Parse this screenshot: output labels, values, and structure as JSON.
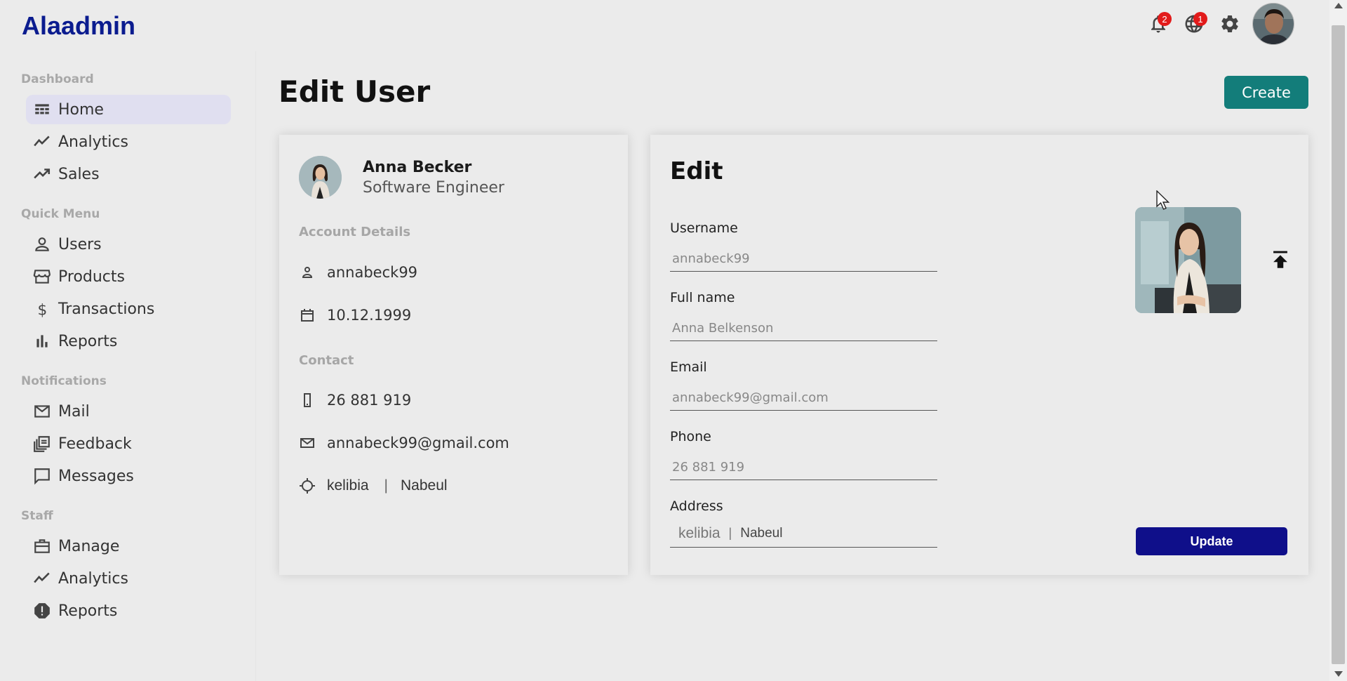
{
  "app": {
    "logo": "Alaadmin",
    "notifications_count": "2",
    "language_count": "1",
    "accent_color": "#137d7a",
    "primary_color": "#0f0f8a",
    "logo_color": "#0b1c8f"
  },
  "sidebar": {
    "sections": [
      {
        "title": "Dashboard",
        "items": [
          {
            "label": "Home",
            "icon": "home-dashboard-icon",
            "active": true
          },
          {
            "label": "Analytics",
            "icon": "line-chart-icon"
          },
          {
            "label": "Sales",
            "icon": "trending-up-icon"
          }
        ]
      },
      {
        "title": "Quick Menu",
        "items": [
          {
            "label": "Users",
            "icon": "person-icon"
          },
          {
            "label": "Products",
            "icon": "storefront-icon"
          },
          {
            "label": "Transactions",
            "icon": "dollar-icon"
          },
          {
            "label": "Reports",
            "icon": "bar-chart-icon"
          }
        ]
      },
      {
        "title": "Notifications",
        "items": [
          {
            "label": "Mail",
            "icon": "mail-icon"
          },
          {
            "label": "Feedback",
            "icon": "feedback-icon"
          },
          {
            "label": "Messages",
            "icon": "chat-icon"
          }
        ]
      },
      {
        "title": "Staff",
        "items": [
          {
            "label": "Manage",
            "icon": "briefcase-icon"
          },
          {
            "label": "Analytics",
            "icon": "line-chart-icon"
          },
          {
            "label": "Reports",
            "icon": "report-alert-icon"
          }
        ]
      }
    ]
  },
  "main": {
    "title": "Edit User",
    "create_label": "Create"
  },
  "user_card": {
    "name": "Anna Becker",
    "job": "Software Engineer",
    "account_section": "Account Details",
    "username": "annabeck99",
    "birthdate": "10.12.1999",
    "contact_section": "Contact",
    "phone": "26 881 919",
    "email": "annabeck99@gmail.com",
    "city": "kelibia",
    "separator": "|",
    "region": "Nabeul"
  },
  "edit_form": {
    "title": "Edit",
    "username_label": "Username",
    "username_placeholder": "annabeck99",
    "fullname_label": "Full name",
    "fullname_placeholder": "Anna Belkenson",
    "email_label": "Email",
    "email_placeholder": "annabeck99@gmail.com",
    "phone_label": "Phone",
    "phone_placeholder": "26 881 919",
    "address_label": "Address",
    "address_city": "kelibia",
    "address_separator": "|",
    "address_region": "Nabeul",
    "update_label": "Update"
  }
}
